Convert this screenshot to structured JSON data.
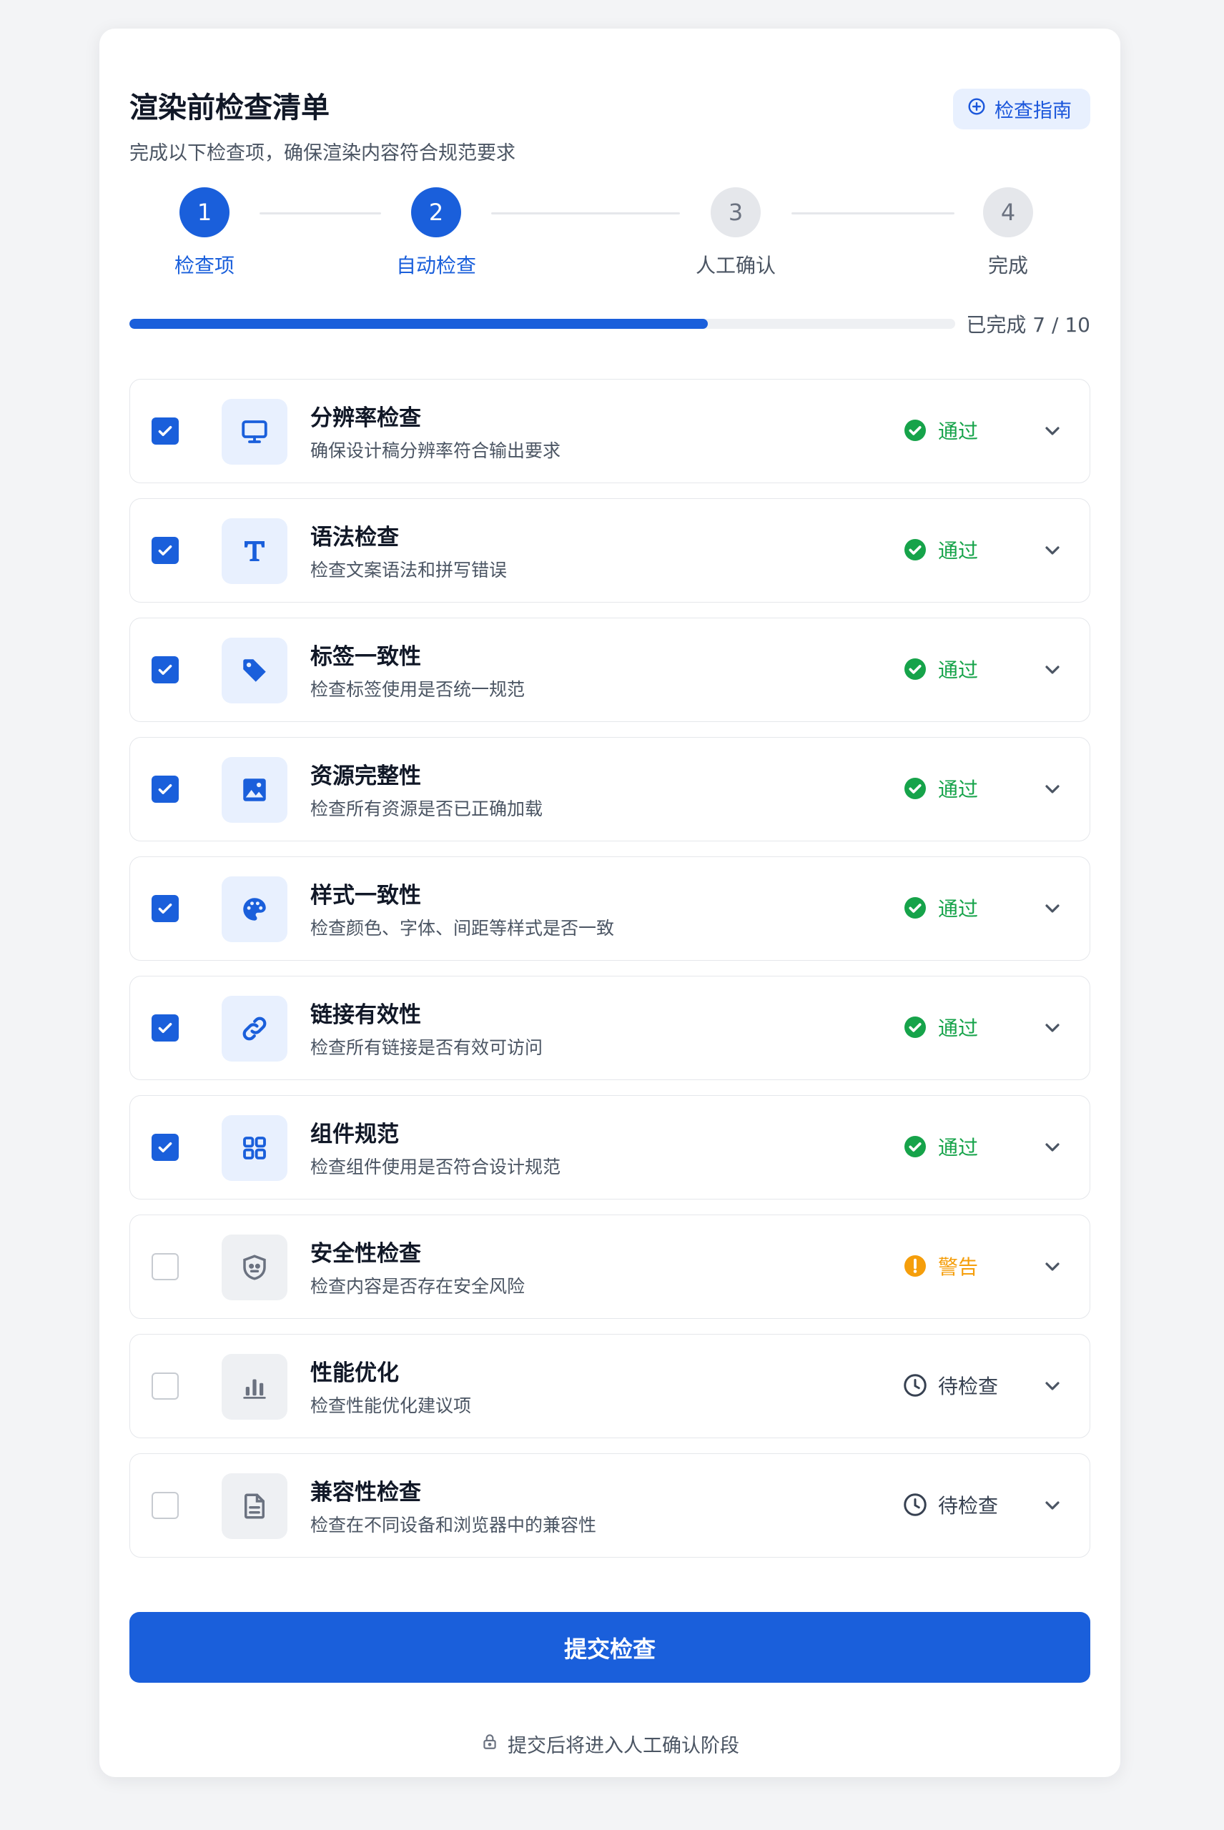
{
  "header": {
    "title": "渲染前检查清单",
    "subtitle": "完成以下检查项，确保渲染内容符合规范要求",
    "guide_button": "检查指南"
  },
  "steps": [
    {
      "number": "1",
      "label": "检查项",
      "state": "active"
    },
    {
      "number": "2",
      "label": "自动检查",
      "state": "active"
    },
    {
      "number": "3",
      "label": "人工确认",
      "state": "pending"
    },
    {
      "number": "4",
      "label": "完成",
      "state": "pending"
    }
  ],
  "progress": {
    "text": "已完成 7 / 10",
    "completed": 7,
    "total": 10
  },
  "items": [
    {
      "name": "分辨率检查",
      "desc": "确保设计稿分辨率符合输出要求",
      "checked": true,
      "icon": "monitor-icon",
      "status": "通过",
      "status_type": "pass"
    },
    {
      "name": "语法检查",
      "desc": "检查文案语法和拼写错误",
      "checked": true,
      "icon": "text-icon",
      "status": "通过",
      "status_type": "pass"
    },
    {
      "name": "标签一致性",
      "desc": "检查标签使用是否统一规范",
      "checked": true,
      "icon": "tag-icon",
      "status": "通过",
      "status_type": "pass"
    },
    {
      "name": "资源完整性",
      "desc": "检查所有资源是否已正确加载",
      "checked": true,
      "icon": "image-icon",
      "status": "通过",
      "status_type": "pass"
    },
    {
      "name": "样式一致性",
      "desc": "检查颜色、字体、间距等样式是否一致",
      "checked": true,
      "icon": "palette-icon",
      "status": "通过",
      "status_type": "pass"
    },
    {
      "name": "链接有效性",
      "desc": "检查所有链接是否有效可访问",
      "checked": true,
      "icon": "link-icon",
      "status": "通过",
      "status_type": "pass"
    },
    {
      "name": "组件规范",
      "desc": "检查组件使用是否符合设计规范",
      "checked": true,
      "icon": "grid-icon",
      "status": "通过",
      "status_type": "pass"
    },
    {
      "name": "安全性检查",
      "desc": "检查内容是否存在安全风险",
      "checked": false,
      "icon": "shield-icon",
      "status": "警告",
      "status_type": "warn"
    },
    {
      "name": "性能优化",
      "desc": "检查性能优化建议项",
      "checked": false,
      "icon": "bar-chart-icon",
      "status": "待检查",
      "status_type": "pending"
    },
    {
      "name": "兼容性检查",
      "desc": "检查在不同设备和浏览器中的兼容性",
      "checked": false,
      "icon": "document-icon",
      "status": "待检查",
      "status_type": "pending"
    }
  ],
  "footer": {
    "submit_label": "提交检查",
    "note": "提交后将进入人工确认阶段"
  },
  "colors": {
    "primary": "#1a5fdb",
    "pass": "#16a34a",
    "warn": "#f59e0b",
    "pending": "#374151"
  }
}
